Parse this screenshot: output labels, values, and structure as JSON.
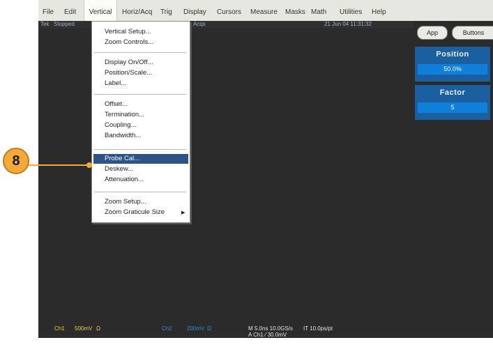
{
  "menubar": {
    "items": [
      "File",
      "Edit",
      "Vertical",
      "Horiz/Acq",
      "Trig",
      "Display",
      "Cursors",
      "Measure",
      "Masks",
      "Math",
      "Utilities",
      "Help"
    ]
  },
  "status": {
    "brand": "Tek",
    "state": "Stopped",
    "acq": "Acqs",
    "datetime": "21 Jun 04 11:31:32"
  },
  "side": {
    "app_button": "App",
    "buttons_button": "Buttons",
    "position": {
      "label": "Position",
      "value": "50.0%"
    },
    "factor": {
      "label": "Factor",
      "value": "5"
    }
  },
  "dropdown": {
    "groups": [
      [
        "Vertical Setup...",
        "Zoom Controls..."
      ],
      [
        "Display On/Off...",
        "Position/Scale...",
        "Label..."
      ],
      [
        "Offset...",
        "Termination...",
        "Coupling...",
        "Bandwidth..."
      ],
      [
        "Probe Cal...",
        "Deskew...",
        "Attenuation..."
      ],
      [
        "Zoom Setup...",
        "Zoom Graticule Size"
      ]
    ],
    "highlighted": "Probe Cal..."
  },
  "readouts": {
    "ch1_label": "Ch1",
    "ch1_scale": "500mV",
    "ch1_term": "Ω",
    "ch2_label": "Ch2",
    "ch2_scale": "200mV",
    "ch2_term": "Ω",
    "timebase": "M 5.0ns 10.0GS/s",
    "trigger": "A  Ch1  ⁄  30.0mV",
    "it": "IT 10.0ps/pt"
  },
  "callout": {
    "number": "8"
  },
  "colors": {
    "screen": "#2b2b2b",
    "panel_blue": "#1a5fa0",
    "value_blue": "#0f7fd9",
    "highlight": "#2e5389",
    "ch1": "#e8d23a",
    "ch2": "#2f8fd8",
    "callout": "#f4a93b"
  }
}
